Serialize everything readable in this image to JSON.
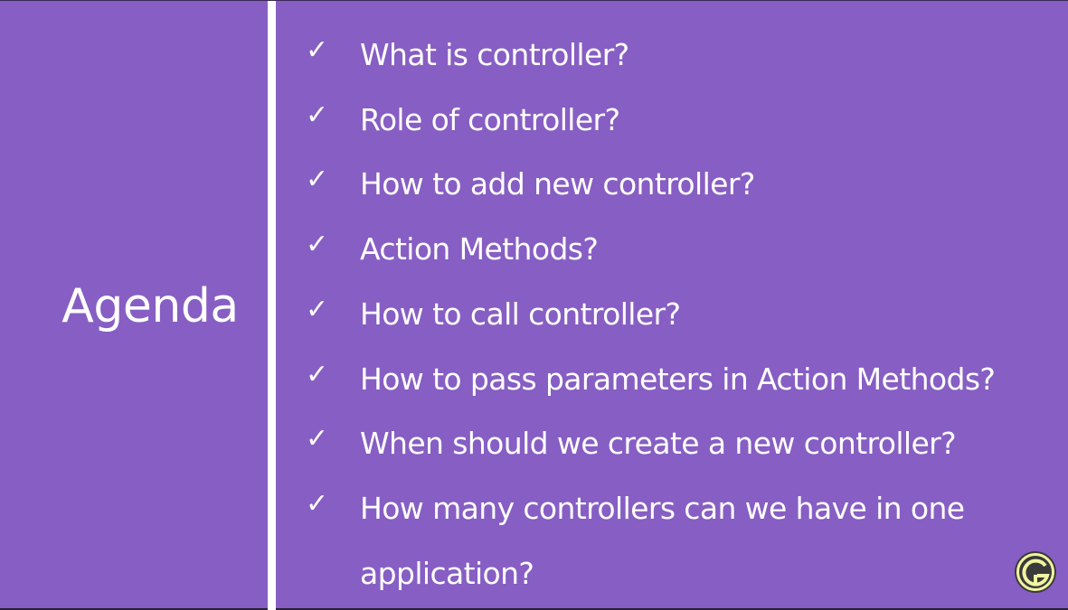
{
  "slide": {
    "title": "Agenda",
    "items": [
      "What is controller?",
      "Role of controller?",
      "How to add new controller?",
      "Action Methods?",
      "How to call controller?",
      "How to pass parameters in Action Methods?",
      "When should we create a new controller?",
      "How many controllers can we have in one application?"
    ],
    "check_glyph": "✓",
    "colors": {
      "background": "#875ec3",
      "text": "#ffffff",
      "logo_ring": "#f1f4a0",
      "logo_fill": "#3a3a3a"
    },
    "icons": {
      "check": "check-icon",
      "logo": "channel-logo-icon"
    }
  }
}
